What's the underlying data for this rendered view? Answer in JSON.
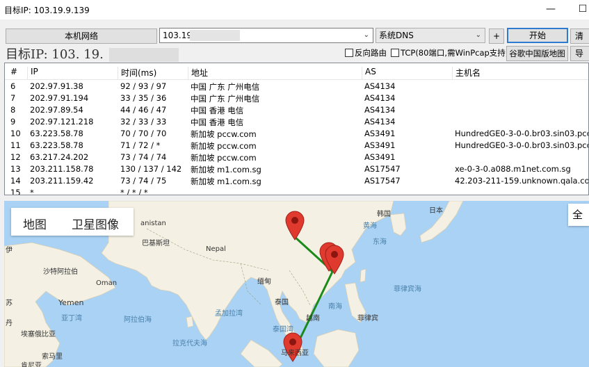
{
  "window": {
    "title": "目标IP: 103.19.9.139",
    "minimize": "—",
    "maximize": "☐"
  },
  "toolbar": {
    "local_network_label": "本机网络",
    "target_value": "103.19.",
    "dns_value": "系统DNS",
    "plus_label": "+",
    "start_label": "开始",
    "extra_label": "清"
  },
  "options": {
    "big_ip_label": "目标IP:",
    "big_ip_value": "103. 19.",
    "reverse_route_label": "反向路由",
    "tcp_label": "TCP(80端口,需WinPcap支持)",
    "google_map_label": "谷歌中国版地图",
    "extra_label": "导"
  },
  "table": {
    "headers": [
      "#",
      "IP",
      "时间(ms)",
      "地址",
      "AS",
      "主机名"
    ],
    "rows": [
      [
        "6",
        "202.97.91.38",
        "92 / 93 / 97",
        "中国 广东 广州电信",
        "AS4134",
        ""
      ],
      [
        "7",
        "202.97.91.194",
        "33 / 35 / 36",
        "中国 广东 广州电信",
        "AS4134",
        ""
      ],
      [
        "8",
        "202.97.89.54",
        "44 / 46 / 47",
        "中国 香港 电信",
        "AS4134",
        ""
      ],
      [
        "9",
        "202.97.121.218",
        "32 / 33 / 33",
        "中国 香港 电信",
        "AS4134",
        ""
      ],
      [
        "10",
        "63.223.58.78",
        "70 / 70 / 70",
        "新加坡 pccw.com",
        "AS3491",
        "HundredGE0-3-0-0.br03.sin03.pccw..."
      ],
      [
        "11",
        "63.223.58.78",
        "71 / 72 / *",
        "新加坡 pccw.com",
        "AS3491",
        "HundredGE0-3-0-0.br03.sin03.pccw..."
      ],
      [
        "12",
        "63.217.24.202",
        "73 / 74 / 74",
        "新加坡 pccw.com",
        "AS3491",
        ""
      ],
      [
        "13",
        "203.211.158.78",
        "130 / 137 / 142",
        "新加坡 m1.com.sg",
        "AS17547",
        "xe-0-3-0.a088.m1net.com.sg"
      ],
      [
        "14",
        "203.211.159.42",
        "73 / 74 / 75",
        "新加坡 m1.com.sg",
        "AS17547",
        "42.203-211-159.unknown.qala.com.sg"
      ],
      [
        "15",
        "*",
        "* / * / *",
        "",
        "",
        ""
      ]
    ]
  },
  "map": {
    "tab_map": "地图",
    "tab_satellite": "卫星图像",
    "fullscreen_label": "全屏",
    "route_color": "#1a8a1a",
    "marker_color": "#e03a2f",
    "labels": {
      "pakistan_partial": "anistan",
      "pakistan": "巴基斯坦",
      "nepal": "Nepal",
      "saudi": "沙特阿拉伯",
      "oman": "Oman",
      "yemen": "Yemen",
      "gulf_aden": "亚丁湾",
      "arabian_sea": "阿拉伯海",
      "bay_bengal": "孟加拉湾",
      "laccadive": "拉克代夫海",
      "myanmar": "缅甸",
      "thailand": "泰国",
      "gulf_thailand": "泰国湾",
      "south_china_sea": "南海",
      "vietnam_south": "越南",
      "philippines": "菲律宾",
      "philippine_sea": "菲律宾海",
      "korea": "韩国",
      "japan": "日本",
      "yellow_sea": "黄海",
      "east_china_sea": "东海",
      "ethiopia": "埃塞俄比亚",
      "somalia": "索马里",
      "kenya": "肯尼亚",
      "malaysia": "马来西亚",
      "letter_i1": "伊",
      "letter_i2": "丹",
      "letter_i3": "苏"
    }
  }
}
